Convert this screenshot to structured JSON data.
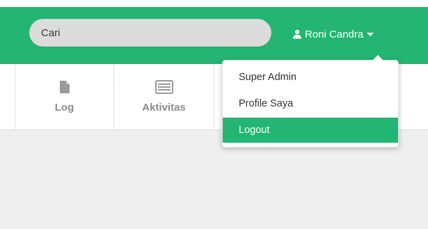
{
  "header": {
    "search": {
      "placeholder": "Cari",
      "value": ""
    },
    "user": {
      "name": "Roni Candra",
      "icon": "user-icon",
      "caret": "chevron-down-icon"
    },
    "brand_color": "#22b573"
  },
  "nav": {
    "items": [
      {
        "label": "Log",
        "icon": "file-icon"
      },
      {
        "label": "Aktivitas",
        "icon": "list-icon"
      }
    ]
  },
  "user_dropdown": {
    "items": [
      {
        "label": "Super Admin",
        "active": false
      },
      {
        "label": "Profile Saya",
        "active": false
      },
      {
        "label": "Logout",
        "active": true
      }
    ]
  },
  "colors": {
    "accent": "#22b573",
    "nav_icon": "#9a9a9a",
    "content_bg": "#efefef"
  }
}
